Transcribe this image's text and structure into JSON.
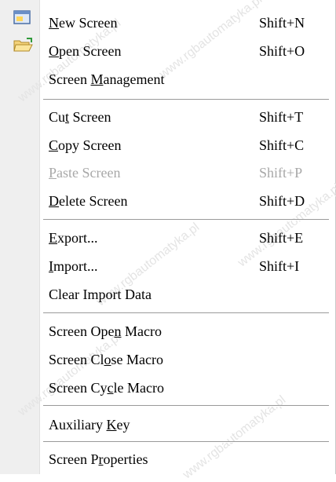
{
  "menu": {
    "items": [
      {
        "id": "new-screen",
        "pre": "",
        "u": "N",
        "post": "ew Screen",
        "shortcut": "Shift+N",
        "enabled": true,
        "icon": "new-screen-icon"
      },
      {
        "id": "open-screen",
        "pre": "",
        "u": "O",
        "post": "pen Screen",
        "shortcut": "Shift+O",
        "enabled": true,
        "icon": "open-folder-icon"
      },
      {
        "id": "screen-management",
        "pre": "Screen ",
        "u": "M",
        "post": "anagement",
        "shortcut": "",
        "enabled": true
      },
      {
        "id": "cut-screen",
        "pre": "Cu",
        "u": "t",
        "post": " Screen",
        "shortcut": "Shift+T",
        "enabled": true
      },
      {
        "id": "copy-screen",
        "pre": "",
        "u": "C",
        "post": "opy Screen",
        "shortcut": "Shift+C",
        "enabled": true
      },
      {
        "id": "paste-screen",
        "pre": "",
        "u": "P",
        "post": "aste Screen",
        "shortcut": "Shift+P",
        "enabled": false
      },
      {
        "id": "delete-screen",
        "pre": "",
        "u": "D",
        "post": "elete Screen",
        "shortcut": "Shift+D",
        "enabled": true
      },
      {
        "id": "export",
        "pre": "",
        "u": "E",
        "post": "xport...",
        "shortcut": "Shift+E",
        "enabled": true
      },
      {
        "id": "import",
        "pre": "",
        "u": "I",
        "post": "mport...",
        "shortcut": "Shift+I",
        "enabled": true
      },
      {
        "id": "clear-import-data",
        "pre": "Clear Import Data",
        "u": "",
        "post": "",
        "shortcut": "",
        "enabled": true
      },
      {
        "id": "screen-open-macro",
        "pre": "Screen Ope",
        "u": "n",
        "post": " Macro",
        "shortcut": "",
        "enabled": true
      },
      {
        "id": "screen-close-macro",
        "pre": "Screen Cl",
        "u": "o",
        "post": "se Macro",
        "shortcut": "",
        "enabled": true
      },
      {
        "id": "screen-cycle-macro",
        "pre": "Screen Cy",
        "u": "c",
        "post": "le Macro",
        "shortcut": "",
        "enabled": true
      },
      {
        "id": "auxiliary-key",
        "pre": "Auxiliary ",
        "u": "K",
        "post": "ey",
        "shortcut": "",
        "enabled": true
      },
      {
        "id": "screen-properties",
        "pre": "Screen P",
        "u": "r",
        "post": "operties",
        "shortcut": "",
        "enabled": true
      }
    ]
  },
  "watermark": {
    "text": "www.rgbautomatyka.pl",
    "color": "#e4e4e4"
  },
  "colors": {
    "gutter": "#efefef",
    "disabled_text": "#a8a8a8",
    "separator": "#9a9a9a"
  }
}
